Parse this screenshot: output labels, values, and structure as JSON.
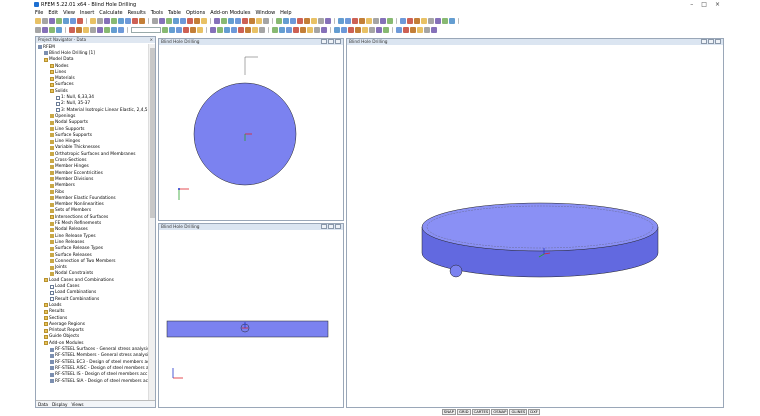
{
  "app": {
    "title": "RFEM 5.22.01 x64 - Blind Hole Drilling"
  },
  "menu": [
    "File",
    "Edit",
    "View",
    "Insert",
    "Calculate",
    "Results",
    "Tools",
    "Table",
    "Options",
    "Add-on Modules",
    "Window",
    "Help"
  ],
  "navigator": {
    "title": "Project Navigator - Data",
    "tree": [
      {
        "label": "RFEM",
        "level": 0,
        "icon": "model"
      },
      {
        "label": "Blind Hole Drilling [1]",
        "level": 1,
        "icon": "model"
      },
      {
        "label": "Model Data",
        "level": 1,
        "icon": "folder"
      },
      {
        "label": "Nodes",
        "level": 2,
        "icon": "folder"
      },
      {
        "label": "Lines",
        "level": 2,
        "icon": "folder"
      },
      {
        "label": "Materials",
        "level": 2,
        "icon": "folder"
      },
      {
        "label": "Surfaces",
        "level": 2,
        "icon": "folder"
      },
      {
        "label": "Solids",
        "level": 2,
        "icon": "folder"
      },
      {
        "label": "1: Null, 6,33,34",
        "level": 3,
        "icon": "doc"
      },
      {
        "label": "2: Null, 35-37",
        "level": 3,
        "icon": "doc"
      },
      {
        "label": "3: Material Isotropic Linear Elastic, 2,4,5",
        "level": 3,
        "icon": "doc"
      },
      {
        "label": "Openings",
        "level": 2,
        "icon": "item"
      },
      {
        "label": "Nodal Supports",
        "level": 2,
        "icon": "item"
      },
      {
        "label": "Line Supports",
        "level": 2,
        "icon": "item"
      },
      {
        "label": "Surface Supports",
        "level": 2,
        "icon": "item"
      },
      {
        "label": "Line Hinges",
        "level": 2,
        "icon": "item"
      },
      {
        "label": "Variable Thicknesses",
        "level": 2,
        "icon": "item"
      },
      {
        "label": "Orthotropic Surfaces and Membranes",
        "level": 2,
        "icon": "item"
      },
      {
        "label": "Cross-Sections",
        "level": 2,
        "icon": "item"
      },
      {
        "label": "Member Hinges",
        "level": 2,
        "icon": "item"
      },
      {
        "label": "Member Eccentricities",
        "level": 2,
        "icon": "item"
      },
      {
        "label": "Member Divisions",
        "level": 2,
        "icon": "item"
      },
      {
        "label": "Members",
        "level": 2,
        "icon": "item"
      },
      {
        "label": "Ribs",
        "level": 2,
        "icon": "item"
      },
      {
        "label": "Member Elastic Foundations",
        "level": 2,
        "icon": "item"
      },
      {
        "label": "Member Nonlinearities",
        "level": 2,
        "icon": "item"
      },
      {
        "label": "Sets of Members",
        "level": 2,
        "icon": "item"
      },
      {
        "label": "Intersections of Surfaces",
        "level": 2,
        "icon": "folder"
      },
      {
        "label": "FE Mesh Refinements",
        "level": 2,
        "icon": "item"
      },
      {
        "label": "Nodal Releases",
        "level": 2,
        "icon": "item"
      },
      {
        "label": "Line Release Types",
        "level": 2,
        "icon": "item"
      },
      {
        "label": "Line Releases",
        "level": 2,
        "icon": "item"
      },
      {
        "label": "Surface Release Types",
        "level": 2,
        "icon": "item"
      },
      {
        "label": "Surface Releases",
        "level": 2,
        "icon": "item"
      },
      {
        "label": "Connection of Two Members",
        "level": 2,
        "icon": "item"
      },
      {
        "label": "Joints",
        "level": 2,
        "icon": "item"
      },
      {
        "label": "Nodal Constraints",
        "level": 2,
        "icon": "item"
      },
      {
        "label": "Load Cases and Combinations",
        "level": 1,
        "icon": "folder"
      },
      {
        "label": "Load Cases",
        "level": 2,
        "icon": "doc"
      },
      {
        "label": "Load Combinations",
        "level": 2,
        "icon": "doc"
      },
      {
        "label": "Result Combinations",
        "level": 2,
        "icon": "doc"
      },
      {
        "label": "Loads",
        "level": 1,
        "icon": "folder"
      },
      {
        "label": "Results",
        "level": 1,
        "icon": "folder"
      },
      {
        "label": "Sections",
        "level": 1,
        "icon": "folder"
      },
      {
        "label": "Average Regions",
        "level": 1,
        "icon": "folder"
      },
      {
        "label": "Printout Reports",
        "level": 1,
        "icon": "folder"
      },
      {
        "label": "Guide Objects",
        "level": 1,
        "icon": "folder"
      },
      {
        "label": "Add-on Modules",
        "level": 1,
        "icon": "folder"
      },
      {
        "label": "RF-STEEL Surfaces - General stress analysis",
        "level": 2,
        "icon": "model"
      },
      {
        "label": "RF-STEEL Members - General stress analysis",
        "level": 2,
        "icon": "model"
      },
      {
        "label": "RF-STEEL EC3 - Design of steel members ac",
        "level": 2,
        "icon": "model"
      },
      {
        "label": "RF-STEEL AISC - Design of steel members a",
        "level": 2,
        "icon": "model"
      },
      {
        "label": "RF-STEEL IS - Design of steel members acc",
        "level": 2,
        "icon": "model"
      },
      {
        "label": "RF-STEEL SIA - Design of steel members acc",
        "level": 2,
        "icon": "model"
      }
    ],
    "tabs": [
      "Data",
      "Display",
      "Views"
    ]
  },
  "windows": {
    "top_left": {
      "title": "Blind Hole Drilling"
    },
    "bottom_left": {
      "title": "Blind Hole Drilling"
    },
    "right": {
      "title": "Blind Hole Drilling"
    }
  },
  "status": [
    "SNAP",
    "GRID",
    "CARTES",
    "OSNAP",
    "GLINES",
    "DXF"
  ],
  "colors": {
    "solid_fill": "#7b82f0",
    "solid_side": "#6269e0",
    "solid_top": "#8a90f5",
    "axis_x": "#e0222a",
    "axis_y": "#2aa32a",
    "axis_z": "#2233cc"
  }
}
